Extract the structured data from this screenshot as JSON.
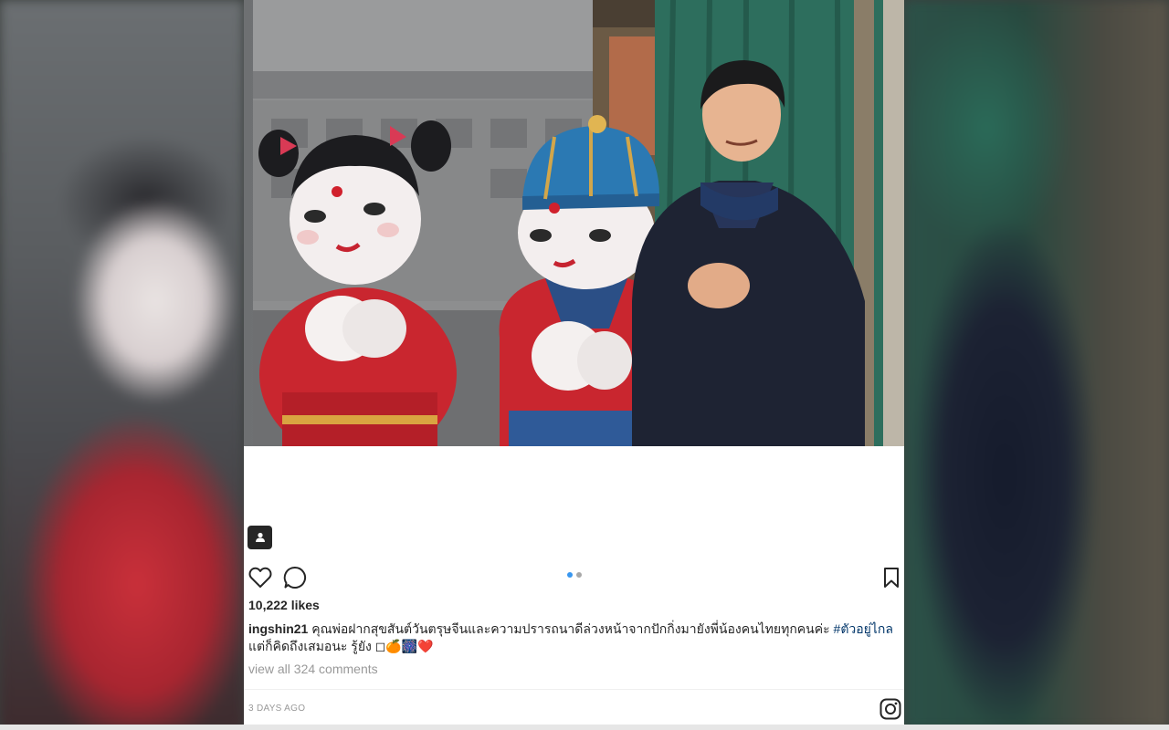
{
  "post": {
    "likes": "10,222 likes",
    "username": "ingshin21",
    "caption_text": " คุณพ่อฝากสุขสันต์วันตรุษจีนและความปรารถนาดีล่วงหน้าจากปักกิ่งมายังพี่น้องคนไทยทุกคนค่ะ ",
    "hashtag": "#ตัวอยู่ไกล",
    "caption_line2": "แต่ก็คิดถึงเสมอนะ รู้ยัง ◻🍊🎆❤️",
    "view_comments": "view all 324 comments",
    "timestamp": "3 DAYS AGO",
    "carousel": {
      "count": 2,
      "active": 1
    }
  },
  "icons": {
    "tag": "tagged-people-icon",
    "like": "heart-outline-icon",
    "comment": "comment-bubble-icon",
    "save": "bookmark-outline-icon",
    "brand": "instagram-logo-icon"
  },
  "colors": {
    "hashtag": "#003569",
    "carousel_active": "#3897f0",
    "muted_text": "#999999",
    "text": "#262626"
  }
}
